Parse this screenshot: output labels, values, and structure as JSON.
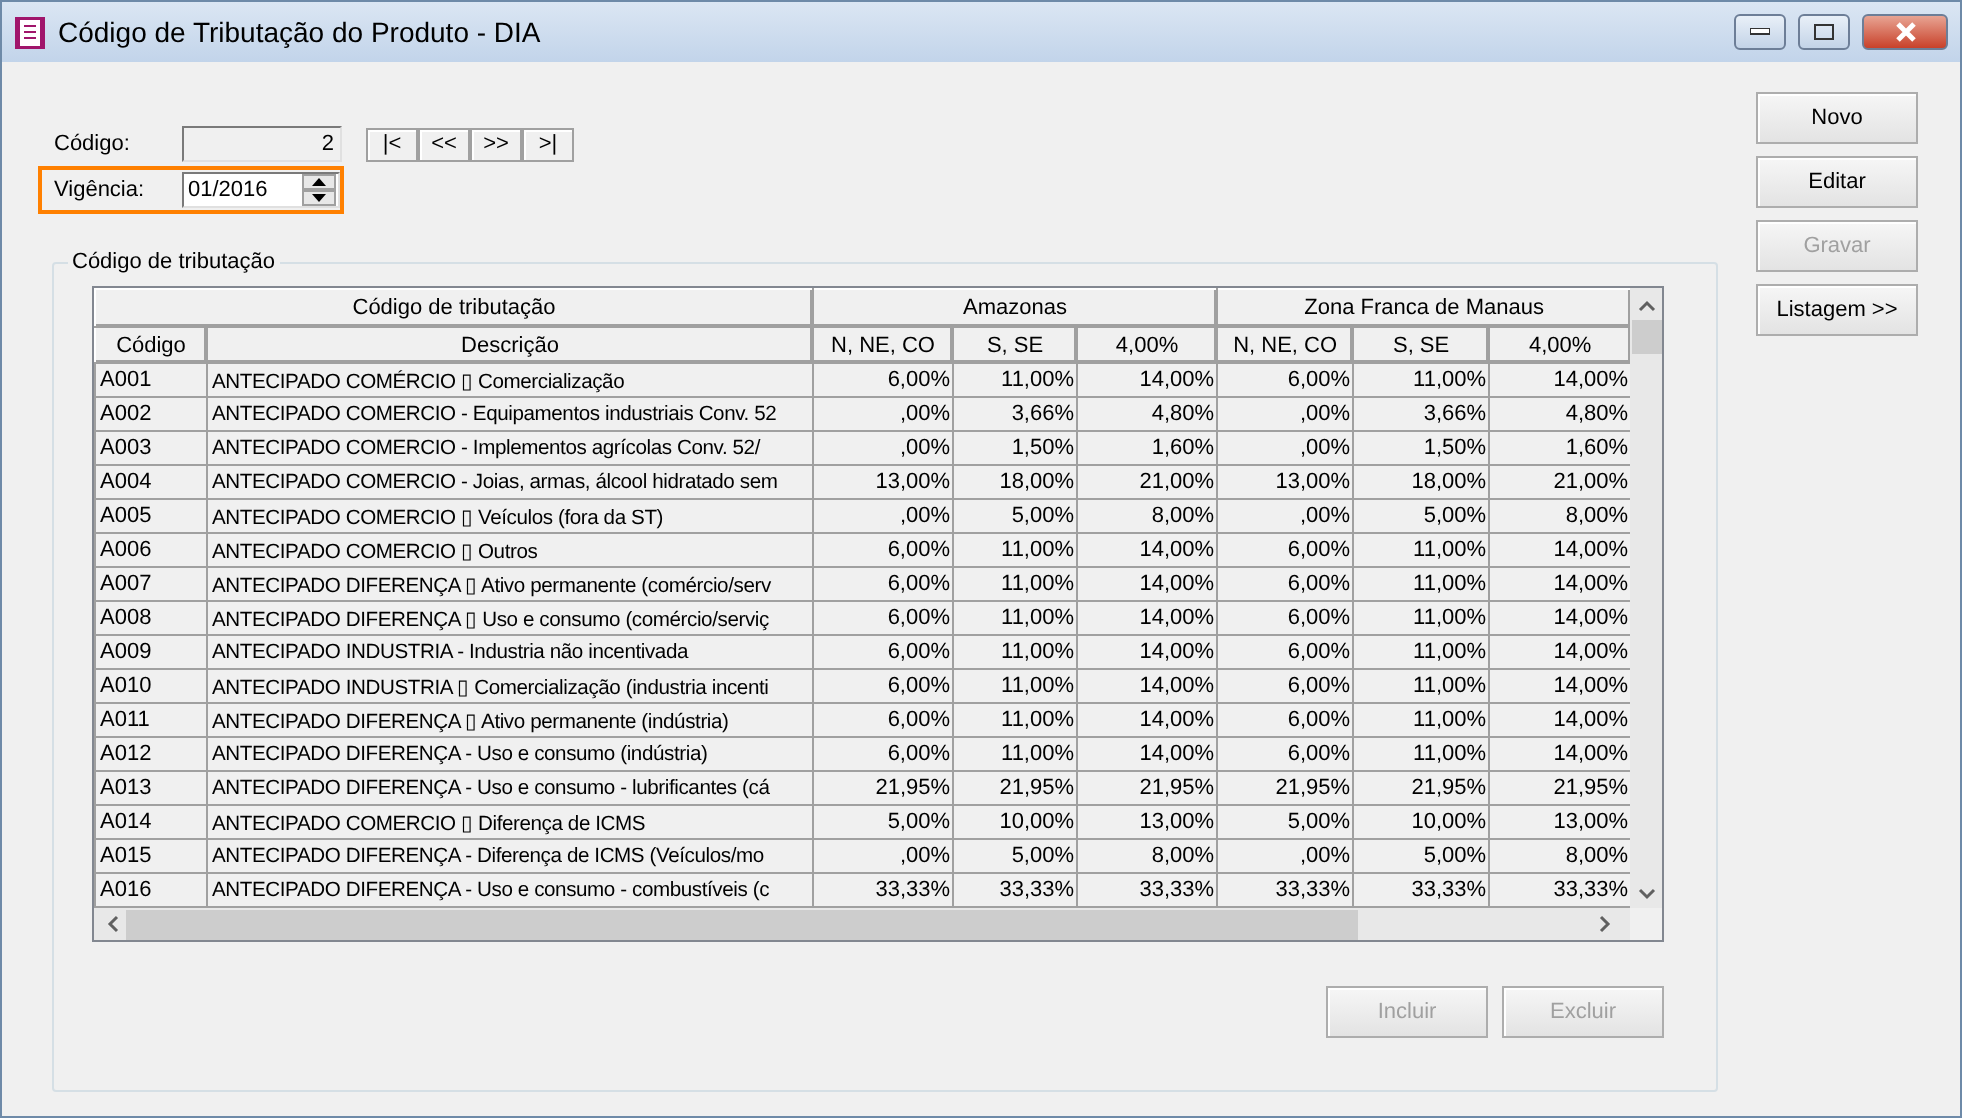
{
  "window": {
    "title": "Código de Tributação do Produto - DIA"
  },
  "form": {
    "codigo": {
      "label": "Código:",
      "value": "2",
      "disabled": true
    },
    "vigencia": {
      "label": "Vigência:",
      "value": "01/2016",
      "highlighted": true
    }
  },
  "nav_buttons": [
    "|<",
    "<<",
    ">>",
    ">|"
  ],
  "side_buttons": [
    {
      "label": "Novo",
      "disabled": false
    },
    {
      "label": "Editar",
      "disabled": false
    },
    {
      "label": "Gravar",
      "disabled": true
    },
    {
      "label": "Listagem >>",
      "disabled": false
    }
  ],
  "group": {
    "title": "Código de tributação"
  },
  "table": {
    "groups": [
      "Código de tributação",
      "Amazonas",
      "Zona Franca de Manaus"
    ],
    "columns": [
      "Código",
      "Descrição",
      "N, NE, CO",
      "S, SE",
      "4,00%",
      "N, NE, CO",
      "S, SE",
      "4,00%"
    ],
    "rows": [
      {
        "code": "A001",
        "description": "ANTECIPADO COMÉRCIO ▯ Comercialização",
        "values": [
          "6,00%",
          "11,00%",
          "14,00%",
          "6,00%",
          "11,00%",
          "14,00%"
        ]
      },
      {
        "code": "A002",
        "description": "ANTECIPADO COMERCIO - Equipamentos industriais Conv. 52",
        "values": [
          ",00%",
          "3,66%",
          "4,80%",
          ",00%",
          "3,66%",
          "4,80%"
        ]
      },
      {
        "code": "A003",
        "description": "ANTECIPADO COMERCIO - Implementos agrícolas Conv. 52/",
        "values": [
          ",00%",
          "1,50%",
          "1,60%",
          ",00%",
          "1,50%",
          "1,60%"
        ]
      },
      {
        "code": "A004",
        "description": "ANTECIPADO COMERCIO - Joias, armas, álcool hidratado sem",
        "values": [
          "13,00%",
          "18,00%",
          "21,00%",
          "13,00%",
          "18,00%",
          "21,00%"
        ]
      },
      {
        "code": "A005",
        "description": "ANTECIPADO COMERCIO ▯ Veículos (fora da ST)",
        "values": [
          ",00%",
          "5,00%",
          "8,00%",
          ",00%",
          "5,00%",
          "8,00%"
        ]
      },
      {
        "code": "A006",
        "description": "ANTECIPADO COMERCIO ▯ Outros",
        "values": [
          "6,00%",
          "11,00%",
          "14,00%",
          "6,00%",
          "11,00%",
          "14,00%"
        ]
      },
      {
        "code": "A007",
        "description": "ANTECIPADO DIFERENÇA ▯ Ativo permanente (comércio/serv",
        "values": [
          "6,00%",
          "11,00%",
          "14,00%",
          "6,00%",
          "11,00%",
          "14,00%"
        ]
      },
      {
        "code": "A008",
        "description": "ANTECIPADO DIFERENÇA ▯ Uso e consumo (comércio/serviç",
        "values": [
          "6,00%",
          "11,00%",
          "14,00%",
          "6,00%",
          "11,00%",
          "14,00%"
        ]
      },
      {
        "code": "A009",
        "description": "ANTECIPADO INDUSTRIA - Industria não incentivada",
        "values": [
          "6,00%",
          "11,00%",
          "14,00%",
          "6,00%",
          "11,00%",
          "14,00%"
        ]
      },
      {
        "code": "A010",
        "description": "ANTECIPADO INDUSTRIA ▯ Comercialização (industria incenti",
        "values": [
          "6,00%",
          "11,00%",
          "14,00%",
          "6,00%",
          "11,00%",
          "14,00%"
        ]
      },
      {
        "code": "A011",
        "description": "ANTECIPADO DIFERENÇA ▯ Ativo permanente (indústria)",
        "values": [
          "6,00%",
          "11,00%",
          "14,00%",
          "6,00%",
          "11,00%",
          "14,00%"
        ]
      },
      {
        "code": "A012",
        "description": "ANTECIPADO DIFERENÇA - Uso e consumo (indústria)",
        "values": [
          "6,00%",
          "11,00%",
          "14,00%",
          "6,00%",
          "11,00%",
          "14,00%"
        ]
      },
      {
        "code": "A013",
        "description": "ANTECIPADO DIFERENÇA - Uso e consumo - lubrificantes (cá",
        "values": [
          "21,95%",
          "21,95%",
          "21,95%",
          "21,95%",
          "21,95%",
          "21,95%"
        ]
      },
      {
        "code": "A014",
        "description": "ANTECIPADO COMERCIO ▯ Diferença de ICMS",
        "values": [
          "5,00%",
          "10,00%",
          "13,00%",
          "5,00%",
          "10,00%",
          "13,00%"
        ]
      },
      {
        "code": "A015",
        "description": "ANTECIPADO DIFERENÇA - Diferença de ICMS (Veículos/mo",
        "values": [
          ",00%",
          "5,00%",
          "8,00%",
          ",00%",
          "5,00%",
          "8,00%"
        ]
      },
      {
        "code": "A016",
        "description": "ANTECIPADO DIFERENÇA - Uso e consumo - combustíveis (c",
        "values": [
          "33,33%",
          "33,33%",
          "33,33%",
          "33,33%",
          "33,33%",
          "33,33%"
        ]
      }
    ]
  },
  "bottom_buttons": [
    {
      "label": "Incluir",
      "disabled": true
    },
    {
      "label": "Excluir",
      "disabled": true
    }
  ]
}
